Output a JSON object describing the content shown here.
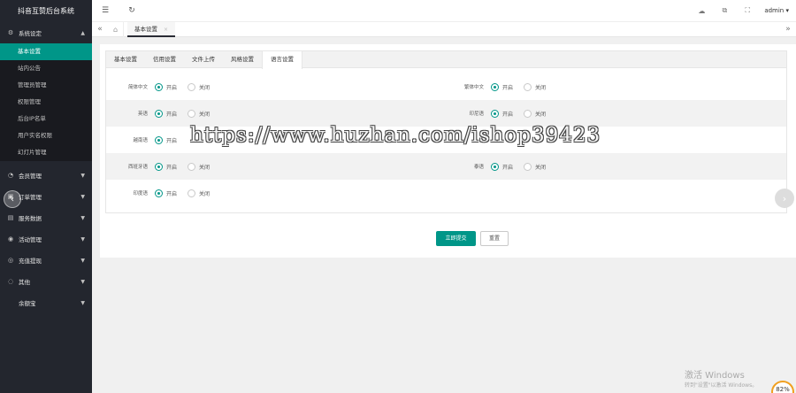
{
  "app_title": "抖音互赞后台系统",
  "sidebar": {
    "groups": [
      {
        "label": "系统设定",
        "icon": "gear-icon",
        "caret": "▲"
      },
      {
        "label": "会员管理",
        "icon": "user-icon",
        "caret": "▼"
      },
      {
        "label": "订单管理",
        "icon": "order-icon",
        "caret": "▼"
      },
      {
        "label": "服务数据",
        "icon": "data-icon",
        "caret": "▼"
      },
      {
        "label": "活动管理",
        "icon": "activity-icon",
        "caret": "▼"
      },
      {
        "label": "充值提现",
        "icon": "wallet-icon",
        "caret": "▼"
      },
      {
        "label": "其他",
        "icon": "other-icon",
        "caret": "▼"
      },
      {
        "label": "余额宝",
        "icon": "",
        "caret": "▼"
      }
    ],
    "sub_items": [
      "基本设置",
      "站内公告",
      "管理员管理",
      "权限管理",
      "后台IP名单",
      "用户实名权限",
      "幻灯片管理"
    ]
  },
  "topbar": {
    "menu_icon": "☰",
    "refresh_icon": "↻",
    "admin": "admin"
  },
  "tabbar": {
    "tab_label": "基本设置",
    "close": "×"
  },
  "subtabs": [
    "基本设置",
    "信用设置",
    "文件上传",
    "风格设置",
    "语言设置"
  ],
  "radio": {
    "on": "开启",
    "off": "关闭"
  },
  "rows": [
    {
      "left": "简体中文",
      "right": "繁体中文"
    },
    {
      "left": "英语",
      "right": "印尼语"
    },
    {
      "left": "越南语",
      "right": ""
    },
    {
      "left": "西班牙语",
      "right": "泰语"
    },
    {
      "left": "印度语",
      "right": ""
    }
  ],
  "buttons": {
    "submit": "立即提交",
    "reset": "重置"
  },
  "watermark": "https://www.huzhan.com/ishop39423",
  "windows": {
    "line1": "激活 Windows",
    "line2": "转到\"设置\"以激活 Windows。"
  },
  "badge": "82%"
}
